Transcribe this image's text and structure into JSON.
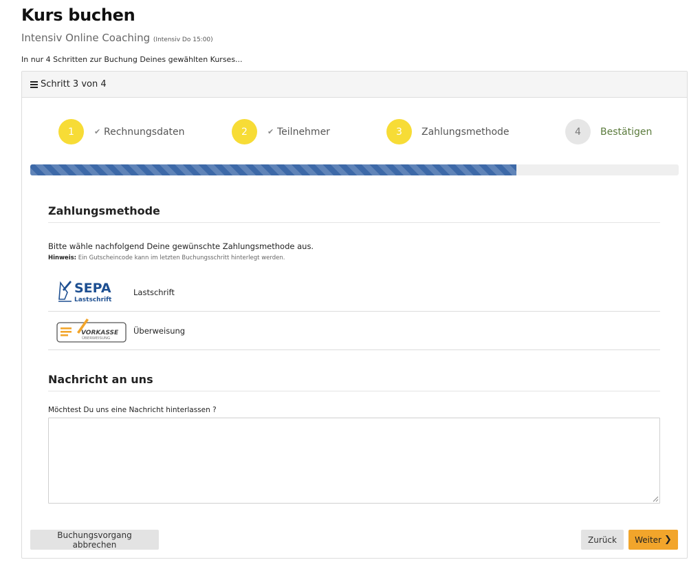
{
  "page": {
    "title": "Kurs buchen",
    "course_name": "Intensiv Online Coaching",
    "course_schedule": "(Intensiv Do 15:00)",
    "intro": "In nur 4 Schritten zur Buchung Deines gewählten Kurses..."
  },
  "panel": {
    "header": "Schritt 3 von 4"
  },
  "steps": [
    {
      "number": "1",
      "label": "Rechnungsdaten",
      "status": "done",
      "check_icon": "check-icon"
    },
    {
      "number": "2",
      "label": "Teilnehmer",
      "status": "done",
      "check_icon": "check-icon"
    },
    {
      "number": "3",
      "label": "Zahlungsmethode",
      "status": "current"
    },
    {
      "number": "4",
      "label": "Bestätigen",
      "status": "pending"
    }
  ],
  "progress": {
    "fraction": 0.75,
    "color": "#3d69a8"
  },
  "payment": {
    "title": "Zahlungsmethode",
    "description": "Bitte wähle nachfolgend Deine gewünschte Zahlungsmethode aus.",
    "note_label": "Hinweis:",
    "note_text": " Ein Gutscheincode kann im letzten Buchungsschritt hinterlegt werden.",
    "methods": [
      {
        "label": "Lastschrift",
        "logo_text": "SEPA",
        "logo_subtext": "Lastschrift",
        "icon": "sepa-logo"
      },
      {
        "label": "Überweisung",
        "logo_text": "VORKASSE",
        "logo_subtext": "ÜBERWEISUNG",
        "icon": "vorkasse-logo"
      }
    ]
  },
  "message": {
    "title": "Nachricht an uns",
    "label": "Möchtest Du uns eine Nachricht hinterlassen ?",
    "value": ""
  },
  "buttons": {
    "cancel": "Buchungsvorgang abbrechen",
    "back": "Zurück",
    "next": "Weiter",
    "next_icon": "chevron-right-icon"
  },
  "colors": {
    "step_active": "#f7dc36",
    "step_pending": "#e6e6e6",
    "next_button": "#f2a52b",
    "sepa_blue": "#1d4f91",
    "vorkasse_orange": "#f2a52b"
  }
}
